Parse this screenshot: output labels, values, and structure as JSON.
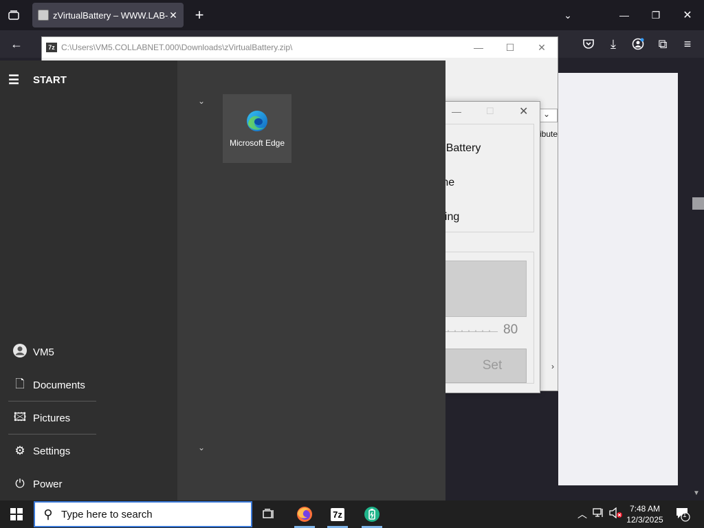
{
  "browser": {
    "tab_title": "zVirtualBattery – WWW.LAB-Z.C",
    "tab_close": "✕",
    "new_tab": "+"
  },
  "zip_window": {
    "title": "C:\\Users\\VM5.COLLABNET.000\\Downloads\\zVirtualBattery.zip\\",
    "app_badge": "7z",
    "column_partial": "ibute"
  },
  "battery_dialog": {
    "line_1": "t: Real Battery",
    "line_2": "y: Online",
    "line_3": "remaining",
    "slider_value": "80",
    "set_button": "Set"
  },
  "start_menu": {
    "header": "START",
    "user": "VM5",
    "items": [
      {
        "label": "Documents"
      },
      {
        "label": "Pictures"
      },
      {
        "label": "Settings"
      },
      {
        "label": "Power"
      }
    ],
    "tile": {
      "label": "Microsoft Edge"
    }
  },
  "taskbar": {
    "search_placeholder": "Type here to search",
    "clock_time": "7:48 AM",
    "clock_date": "12/3/2025",
    "app_7z": "7z",
    "notification_count": "1"
  },
  "colors": {
    "accent": "#3b7ad9",
    "start_bg": "#3a3a3a",
    "taskbar_bg": "#202020"
  }
}
